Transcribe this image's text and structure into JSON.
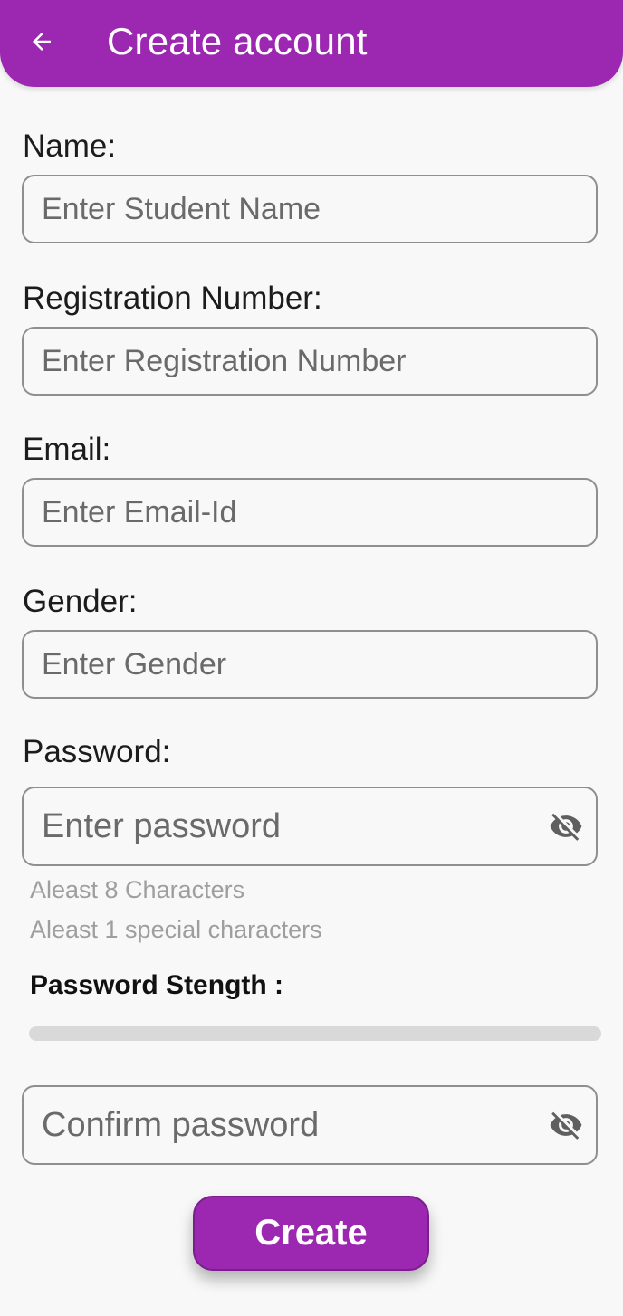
{
  "app": {
    "title": "Create account",
    "accent_color": "#9c27b0",
    "back_icon": "arrow-left-icon"
  },
  "form": {
    "name": {
      "label": "Name:",
      "placeholder": "Enter Student Name",
      "value": ""
    },
    "registration": {
      "label": "Registration Number:",
      "placeholder": "Enter Registration Number",
      "value": ""
    },
    "email": {
      "label": "Email:",
      "placeholder": "Enter Email-Id",
      "value": ""
    },
    "gender": {
      "label": "Gender:",
      "placeholder": "Enter Gender",
      "value": ""
    },
    "password": {
      "label": "Password:",
      "placeholder": "Enter password",
      "value": "",
      "visibility_icon": "eye-off-icon",
      "hints": [
        "Aleast 8 Characters",
        "Aleast 1 special characters"
      ]
    },
    "strength": {
      "label": "Password Stength :",
      "level": 0
    },
    "confirm_password": {
      "placeholder": "Confirm password",
      "value": "",
      "visibility_icon": "eye-off-icon"
    },
    "submit_label": "Create"
  }
}
